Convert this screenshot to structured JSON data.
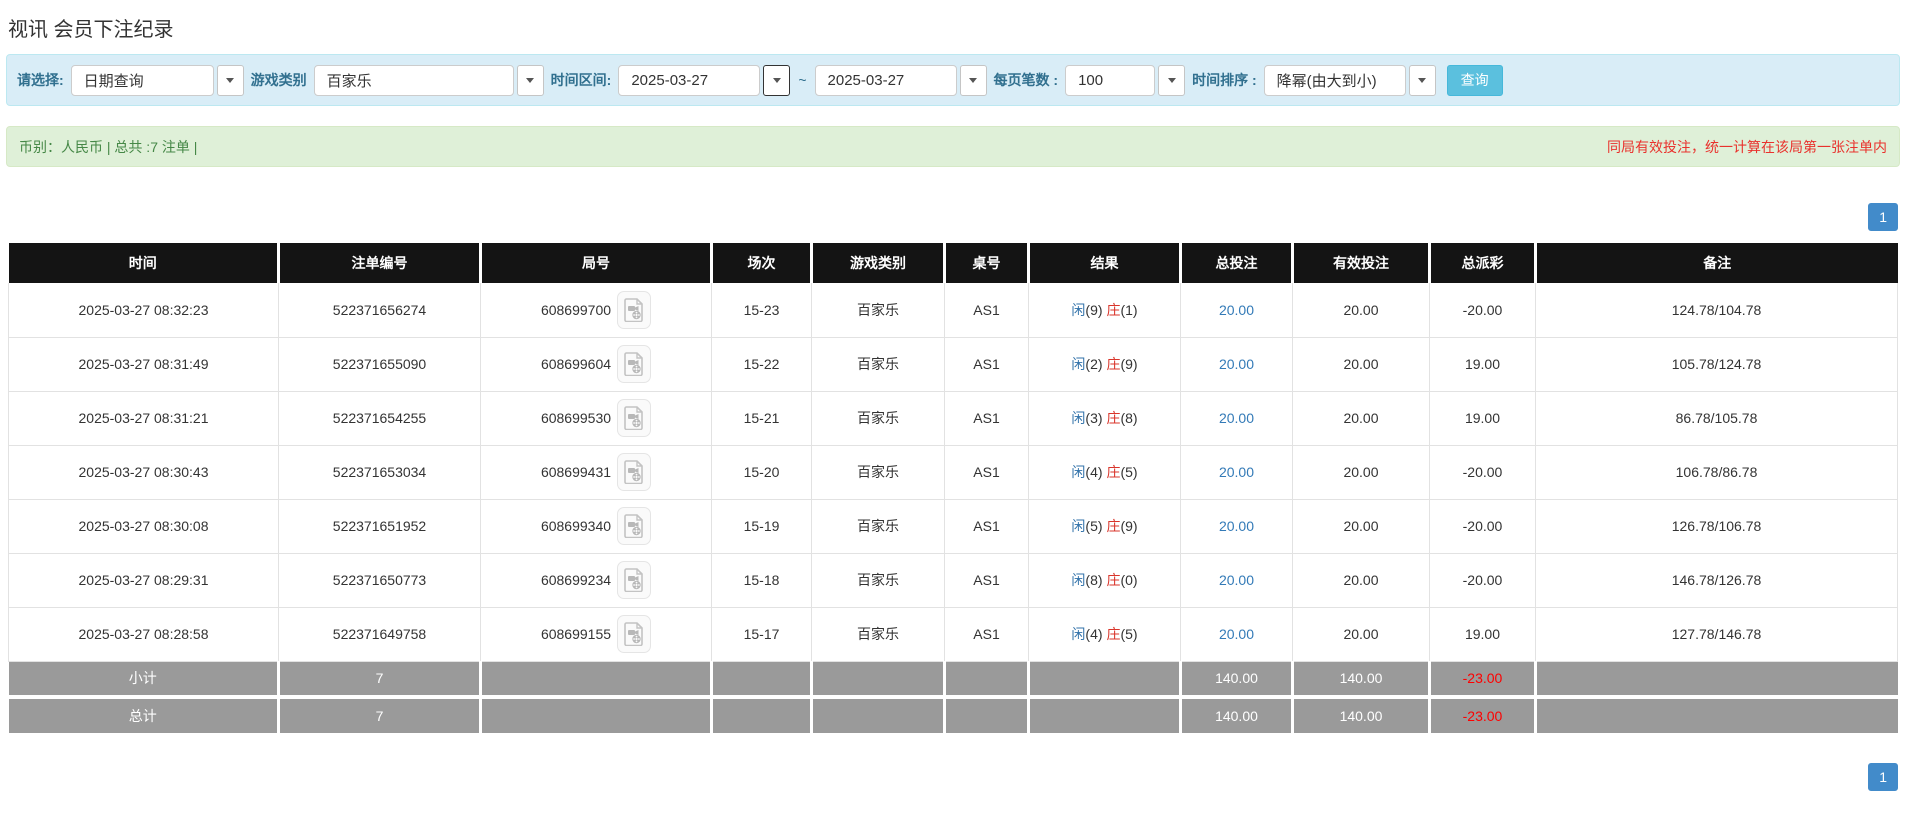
{
  "page": {
    "title": "视讯 会员下注纪录"
  },
  "filters": {
    "query_type": {
      "label": "请选择:",
      "value": "日期查询"
    },
    "game_category": {
      "label": "游戏类别",
      "value": "百家乐"
    },
    "date_range": {
      "label": "时间区间:",
      "from": "2025-03-27",
      "to": "2025-03-27",
      "separator": "~"
    },
    "page_size": {
      "label": "每页笔数 :",
      "value": "100"
    },
    "time_sort": {
      "label": "时间排序 :",
      "value": "降幂(由大到小)"
    },
    "search_button": "查询"
  },
  "summary_bar": {
    "left": "币别：人民币 | 总共 :7 注单 |",
    "right": "同局有效投注，统一计算在该局第一张注单内"
  },
  "pagination": {
    "page": "1"
  },
  "icons": {
    "dropdown_caret": "caret-down-icon",
    "round_video": "video-file-icon"
  },
  "colors": {
    "filter_bg": "#d9edf7",
    "filter_text": "#31708f",
    "success_bg": "#dff0d8",
    "success_text": "#468847",
    "warning_red": "#e9322d",
    "link_blue": "#337ab7",
    "player_blue": "#3071a9",
    "banker_red": "#d9352b",
    "negative_red": "#ff0000",
    "header_bg": "#141414",
    "summary_row_bg": "#9a9a9a",
    "pager_blue": "#428bca",
    "button_blue": "#5bc0de"
  },
  "table": {
    "headers": [
      "时间",
      "注单编号",
      "局号",
      "场次",
      "游戏类别",
      "桌号",
      "结果",
      "总投注",
      "有效投注",
      "总派彩",
      "备注"
    ],
    "rows": [
      {
        "time": "2025-03-27 08:32:23",
        "bet_id": "522371656274",
        "round_id": "608699700",
        "session": "15-23",
        "game": "百家乐",
        "table_no": "AS1",
        "player_label": "闲",
        "player_num": "(9)",
        "banker_label": "庄",
        "banker_num": "(1)",
        "total_bet": "20.00",
        "valid_bet": "20.00",
        "payout": "-20.00",
        "remark": "124.78/104.78"
      },
      {
        "time": "2025-03-27 08:31:49",
        "bet_id": "522371655090",
        "round_id": "608699604",
        "session": "15-22",
        "game": "百家乐",
        "table_no": "AS1",
        "player_label": "闲",
        "player_num": "(2)",
        "banker_label": "庄",
        "banker_num": "(9)",
        "total_bet": "20.00",
        "valid_bet": "20.00",
        "payout": "19.00",
        "remark": "105.78/124.78"
      },
      {
        "time": "2025-03-27 08:31:21",
        "bet_id": "522371654255",
        "round_id": "608699530",
        "session": "15-21",
        "game": "百家乐",
        "table_no": "AS1",
        "player_label": "闲",
        "player_num": "(3)",
        "banker_label": "庄",
        "banker_num": "(8)",
        "total_bet": "20.00",
        "valid_bet": "20.00",
        "payout": "19.00",
        "remark": "86.78/105.78"
      },
      {
        "time": "2025-03-27 08:30:43",
        "bet_id": "522371653034",
        "round_id": "608699431",
        "session": "15-20",
        "game": "百家乐",
        "table_no": "AS1",
        "player_label": "闲",
        "player_num": "(4)",
        "banker_label": "庄",
        "banker_num": "(5)",
        "total_bet": "20.00",
        "valid_bet": "20.00",
        "payout": "-20.00",
        "remark": "106.78/86.78"
      },
      {
        "time": "2025-03-27 08:30:08",
        "bet_id": "522371651952",
        "round_id": "608699340",
        "session": "15-19",
        "game": "百家乐",
        "table_no": "AS1",
        "player_label": "闲",
        "player_num": "(5)",
        "banker_label": "庄",
        "banker_num": "(9)",
        "total_bet": "20.00",
        "valid_bet": "20.00",
        "payout": "-20.00",
        "remark": "126.78/106.78"
      },
      {
        "time": "2025-03-27 08:29:31",
        "bet_id": "522371650773",
        "round_id": "608699234",
        "session": "15-18",
        "game": "百家乐",
        "table_no": "AS1",
        "player_label": "闲",
        "player_num": "(8)",
        "banker_label": "庄",
        "banker_num": "(0)",
        "total_bet": "20.00",
        "valid_bet": "20.00",
        "payout": "-20.00",
        "remark": "146.78/126.78"
      },
      {
        "time": "2025-03-27 08:28:58",
        "bet_id": "522371649758",
        "round_id": "608699155",
        "session": "15-17",
        "game": "百家乐",
        "table_no": "AS1",
        "player_label": "闲",
        "player_num": "(4)",
        "banker_label": "庄",
        "banker_num": "(5)",
        "total_bet": "20.00",
        "valid_bet": "20.00",
        "payout": "19.00",
        "remark": "127.78/146.78"
      }
    ],
    "subtotal": {
      "label": "小计",
      "count": "7",
      "total_bet": "140.00",
      "valid_bet": "140.00",
      "payout": "-23.00"
    },
    "total": {
      "label": "总计",
      "count": "7",
      "total_bet": "140.00",
      "valid_bet": "140.00",
      "payout": "-23.00"
    }
  }
}
